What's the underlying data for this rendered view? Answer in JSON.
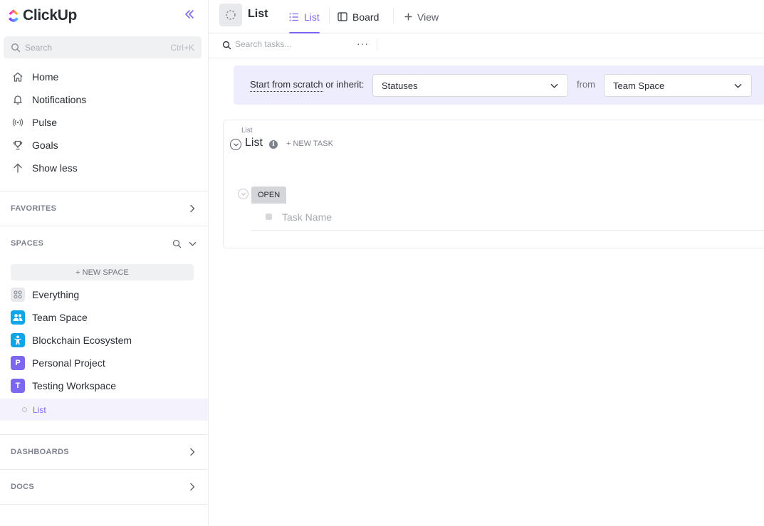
{
  "app": {
    "logo_text": "ClickUp",
    "accent": "#7b68ee"
  },
  "sidebar": {
    "search": {
      "placeholder": "Search",
      "shortcut": "Ctrl+K"
    },
    "nav": [
      {
        "label": "Home",
        "icon": "home-icon"
      },
      {
        "label": "Notifications",
        "icon": "bell-icon"
      },
      {
        "label": "Pulse",
        "icon": "pulse-icon"
      },
      {
        "label": "Goals",
        "icon": "trophy-icon"
      },
      {
        "label": "Show less",
        "icon": "arrow-up-icon"
      }
    ],
    "favorites_title": "FAVORITES",
    "spaces_title": "SPACES",
    "new_space_label": "+ NEW SPACE",
    "spaces": [
      {
        "label": "Everything",
        "icon": "grid-icon",
        "color": "#e8e9ec"
      },
      {
        "label": "Team Space",
        "icon": "people-icon",
        "color": "#0ea5e9"
      },
      {
        "label": "Blockchain Ecosystem",
        "icon": "person-icon",
        "color": "#0ea5e9"
      },
      {
        "label": "Personal Project",
        "initial": "P",
        "color": "#7b68ee"
      },
      {
        "label": "Testing Workspace",
        "initial": "T",
        "color": "#7b68ee"
      }
    ],
    "active_list": "List",
    "dashboards_title": "DASHBOARDS",
    "docs_title": "DOCS"
  },
  "header": {
    "title": "List",
    "tabs": [
      {
        "label": "List",
        "icon": "list-icon",
        "active": true
      },
      {
        "label": "Board",
        "icon": "board-icon",
        "active": false
      }
    ],
    "add_view_label": "View"
  },
  "toolbar": {
    "search_placeholder": "Search tasks...",
    "more_label": "···"
  },
  "banner": {
    "prompt_dotted": "Start from scratch",
    "prompt_rest": " or inherit:",
    "statuses_value": "Statuses",
    "from_label": "from",
    "space_value": "Team Space"
  },
  "list_card": {
    "breadcrumb": "List",
    "title": "List",
    "new_task_label": "+ NEW TASK",
    "status_label": "OPEN",
    "task_placeholder": "Task Name"
  }
}
